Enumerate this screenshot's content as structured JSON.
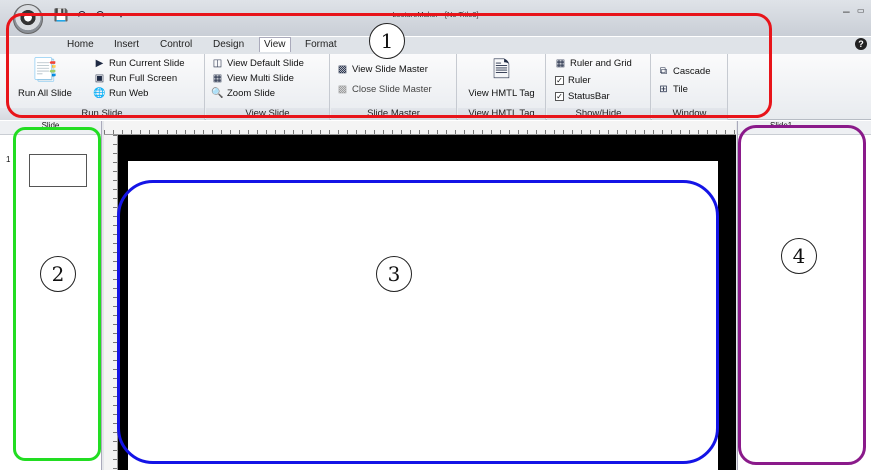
{
  "window": {
    "title": "LectureMaker - [No Title3]"
  },
  "qat": {
    "save_icon": "save-icon",
    "undo_icon": "undo-icon",
    "redo_icon": "redo-icon",
    "customize_icon": "dropdown-icon"
  },
  "tabs": [
    {
      "label": "Home"
    },
    {
      "label": "Insert"
    },
    {
      "label": "Control"
    },
    {
      "label": "Design"
    },
    {
      "label": "View"
    },
    {
      "label": "Format"
    }
  ],
  "active_tab": "View",
  "ribbon": {
    "run_slide": {
      "label": "Run Slide",
      "run_all": "Run All Slide",
      "run_current": "Run Current Slide",
      "run_full": "Run Full Screen",
      "run_web": "Run Web"
    },
    "view_slide": {
      "label": "View Slide",
      "default": "View Default Slide",
      "multi": "View Multi Slide",
      "zoom": "Zoom Slide"
    },
    "slide_master": {
      "label": "Slide Master",
      "view": "View Slide Master",
      "close": "Close Slide Master"
    },
    "html_tag": {
      "label": "View HMTL Tag",
      "button": "View HMTL Tag"
    },
    "show_hide": {
      "label": "Show/Hide",
      "ruler_grid": "Ruler and Grid",
      "ruler": "Ruler",
      "statusbar": "StatusBar",
      "ruler_checked": true,
      "statusbar_checked": true
    },
    "window": {
      "label": "Window",
      "cascade": "Cascade",
      "tile": "Tile"
    }
  },
  "slide_panel": {
    "header": "Slide",
    "thumb_number": "1"
  },
  "property_panel": {
    "header": "Slide1"
  },
  "callouts": [
    {
      "number": "1",
      "color": "#e8141a"
    },
    {
      "number": "2",
      "color": "#22dd22"
    },
    {
      "number": "3",
      "color": "#1414e6"
    },
    {
      "number": "4",
      "color": "#8a1a8a"
    }
  ]
}
